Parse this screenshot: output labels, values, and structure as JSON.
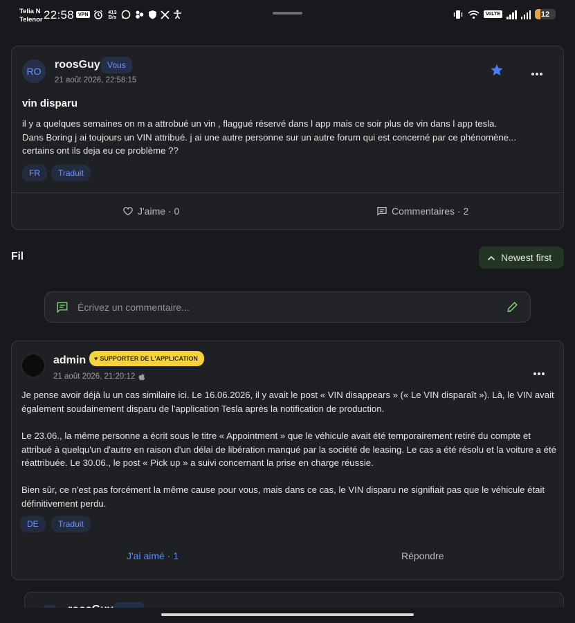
{
  "status_bar": {
    "carrier_1": "Telia N",
    "carrier_2": "Telenor",
    "time": "22:58",
    "vpn": "VPN",
    "net_speed_value": "413",
    "net_speed_unit": "B/s",
    "volte": "VoLTE",
    "battery": "12"
  },
  "post": {
    "avatar_initials": "RO",
    "author": "roosGuy",
    "you_badge": "Vous",
    "timestamp": "21 août 2026, 22:58:15",
    "title": "vin disparu",
    "body": "il y a quelques semaines on m a attrobué un vin , flaggué réservé dans l app mais ce soir plus de vin dans l app tesla.\nDans Boring j ai toujours un VIN attribué.  j ai une autre personne sur un autre forum qui est concerné par ce phénomène...\ncertains ont ils deja eu ce problème ??",
    "lang_chip": "FR",
    "translated_chip": "Traduit",
    "like_label": "J'aime · 0",
    "comments_label": "Commentaires · 2",
    "star_color": "#4a7cf6"
  },
  "feed": {
    "title": "Fil",
    "sort_button": "Newest first"
  },
  "comment_input": {
    "placeholder": "Écrivez un commentaire..."
  },
  "comment": {
    "author": "admin",
    "supporter_badge": "SUPPORTER DE L'APPLICATION",
    "timestamp": "21 août 2026, 21:20:12",
    "paragraph_1": "Je pense avoir déjà lu un cas similaire ici. Le 16.06.2026, il y avait le post « VIN disappears » (« Le VIN disparaît »). Là, le VIN avait également soudainement disparu de l'application Tesla après la notification de production.",
    "paragraph_2": "Le 23.06., la même personne a écrit sous le titre « Appointment » que le véhicule avait été temporairement retiré du compte et attribué à quelqu'un d'autre en raison d'un délai de libération manqué par la société de leasing. Le cas a été résolu et la voiture a été réattribuée. Le 30.06., le post « Pick up » a suivi concernant la prise en charge réussie.",
    "paragraph_3": "Bien sûr, ce n'est pas forcément la même cause pour vous, mais dans ce cas, le VIN disparu ne signifiait pas que le véhicule était définitivement perdu.",
    "lang_chip": "DE",
    "translated_chip": "Traduit",
    "liked_label": "J'ai aimé · 1",
    "reply_label": "Répondre",
    "liked_color": "#5b8af7"
  },
  "nested_reply": {
    "author": "roosGuy"
  }
}
